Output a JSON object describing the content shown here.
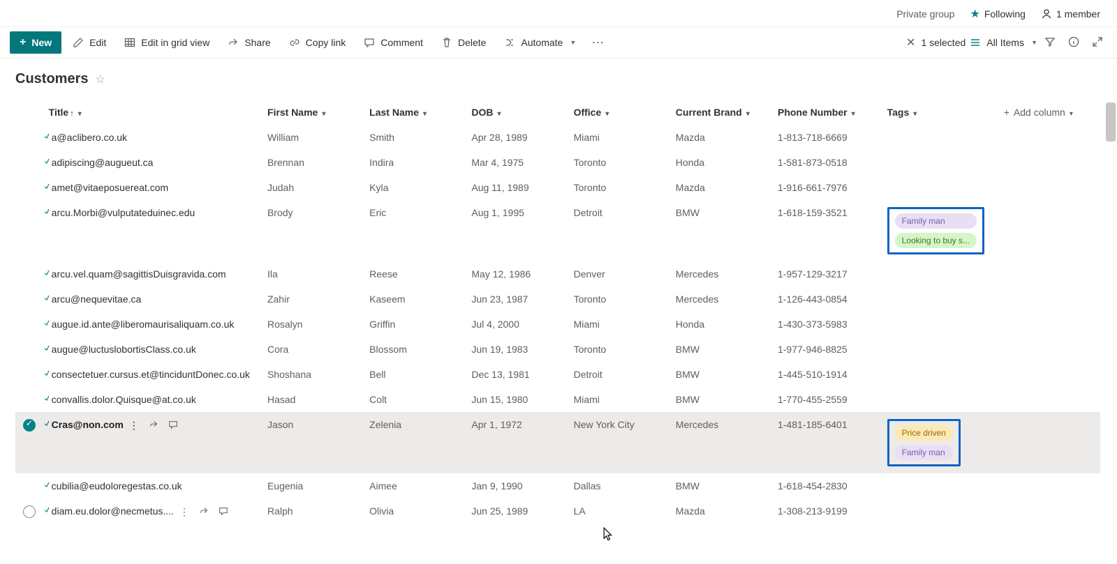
{
  "header": {
    "privacy": "Private group",
    "following": "Following",
    "members": "1 member"
  },
  "commands": {
    "new": "New",
    "edit": "Edit",
    "grid": "Edit in grid view",
    "share": "Share",
    "copy": "Copy link",
    "comment": "Comment",
    "delete": "Delete",
    "automate": "Automate",
    "selected": "1 selected",
    "view": "All Items"
  },
  "list": {
    "title": "Customers"
  },
  "columns": {
    "title": "Title",
    "first": "First Name",
    "last": "Last Name",
    "dob": "DOB",
    "office": "Office",
    "brand": "Current Brand",
    "phone": "Phone Number",
    "tags": "Tags",
    "add": "Add column"
  },
  "tags": {
    "family": "Family man",
    "looking": "Looking to buy s...",
    "price": "Price driven"
  },
  "rows": [
    {
      "title": "a@aclibero.co.uk",
      "first": "William",
      "last": "Smith",
      "dob": "Apr 28, 1989",
      "office": "Miami",
      "brand": "Mazda",
      "phone": "1-813-718-6669"
    },
    {
      "title": "adipiscing@augueut.ca",
      "first": "Brennan",
      "last": "Indira",
      "dob": "Mar 4, 1975",
      "office": "Toronto",
      "brand": "Honda",
      "phone": "1-581-873-0518"
    },
    {
      "title": "amet@vitaeposuereat.com",
      "first": "Judah",
      "last": "Kyla",
      "dob": "Aug 11, 1989",
      "office": "Toronto",
      "brand": "Mazda",
      "phone": "1-916-661-7976"
    },
    {
      "title": "arcu.Morbi@vulputateduinec.edu",
      "first": "Brody",
      "last": "Eric",
      "dob": "Aug 1, 1995",
      "office": "Detroit",
      "brand": "BMW",
      "phone": "1-618-159-3521",
      "tags": [
        "family",
        "looking"
      ]
    },
    {
      "title": "arcu.vel.quam@sagittisDuisgravida.com",
      "first": "Ila",
      "last": "Reese",
      "dob": "May 12, 1986",
      "office": "Denver",
      "brand": "Mercedes",
      "phone": "1-957-129-3217"
    },
    {
      "title": "arcu@nequevitae.ca",
      "first": "Zahir",
      "last": "Kaseem",
      "dob": "Jun 23, 1987",
      "office": "Toronto",
      "brand": "Mercedes",
      "phone": "1-126-443-0854"
    },
    {
      "title": "augue.id.ante@liberomaurisaliquam.co.uk",
      "first": "Rosalyn",
      "last": "Griffin",
      "dob": "Jul 4, 2000",
      "office": "Miami",
      "brand": "Honda",
      "phone": "1-430-373-5983"
    },
    {
      "title": "augue@luctuslobortisClass.co.uk",
      "first": "Cora",
      "last": "Blossom",
      "dob": "Jun 19, 1983",
      "office": "Toronto",
      "brand": "BMW",
      "phone": "1-977-946-8825"
    },
    {
      "title": "consectetuer.cursus.et@tinciduntDonec.co.uk",
      "first": "Shoshana",
      "last": "Bell",
      "dob": "Dec 13, 1981",
      "office": "Detroit",
      "brand": "BMW",
      "phone": "1-445-510-1914"
    },
    {
      "title": "convallis.dolor.Quisque@at.co.uk",
      "first": "Hasad",
      "last": "Colt",
      "dob": "Jun 15, 1980",
      "office": "Miami",
      "brand": "BMW",
      "phone": "1-770-455-2559"
    },
    {
      "title": "Cras@non.com",
      "first": "Jason",
      "last": "Zelenia",
      "dob": "Apr 1, 1972",
      "office": "New York City",
      "brand": "Mercedes",
      "phone": "1-481-185-6401",
      "tags": [
        "price",
        "family"
      ],
      "selected": true,
      "actions": true
    },
    {
      "title": "cubilia@eudoloregestas.co.uk",
      "first": "Eugenia",
      "last": "Aimee",
      "dob": "Jan 9, 1990",
      "office": "Dallas",
      "brand": "BMW",
      "phone": "1-618-454-2830"
    },
    {
      "title": "diam.eu.dolor@necmetus....",
      "first": "Ralph",
      "last": "Olivia",
      "dob": "Jun 25, 1989",
      "office": "LA",
      "brand": "Mazda",
      "phone": "1-308-213-9199",
      "hover": true,
      "actions": true
    }
  ],
  "tagColors": {
    "family": "purple",
    "looking": "green",
    "price": "yellow"
  }
}
